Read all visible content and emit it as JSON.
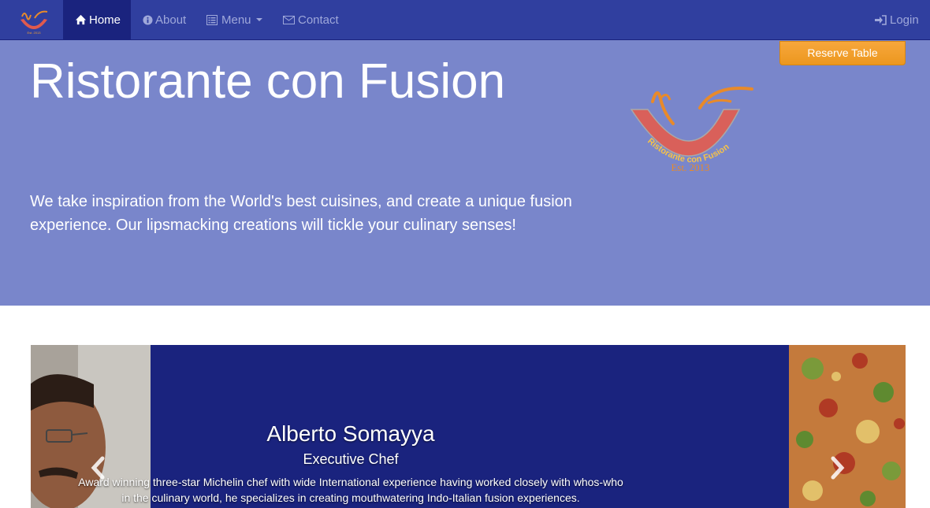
{
  "nav": {
    "brand_icon": "restaurant-logo",
    "items": [
      {
        "label": "Home",
        "icon": "home-icon",
        "active": true
      },
      {
        "label": "About",
        "icon": "info-circle-icon"
      },
      {
        "label": "Menu",
        "icon": "list-alt-icon",
        "dropdown": true
      },
      {
        "label": "Contact",
        "icon": "envelope-icon"
      }
    ],
    "login": {
      "label": "Login",
      "icon": "log-in-icon"
    }
  },
  "jumbotron": {
    "title": "Ristorante con Fusion",
    "text": "We take inspiration from the World's best cuisines, and create a unique fusion experience. Our lipsmacking creations will tickle your culinary senses!",
    "logo_text": "Ristorante con Fusion",
    "logo_est": "Est. 2013",
    "reserve_button": "Reserve Table"
  },
  "carousel": {
    "name": "Alberto Somayya",
    "role": "Executive Chef",
    "description": "Award winning three-star Michelin chef with wide International experience having worked closely with whos-who in the culinary world, he specializes in creating mouthwatering Indo-Italian fusion experiences."
  },
  "colors": {
    "navbar": "#303F9F",
    "nav_active": "#1A237E",
    "jumbotron": "#7986CB",
    "carousel": "#1A237E",
    "reserve_button": "#F0A030"
  }
}
